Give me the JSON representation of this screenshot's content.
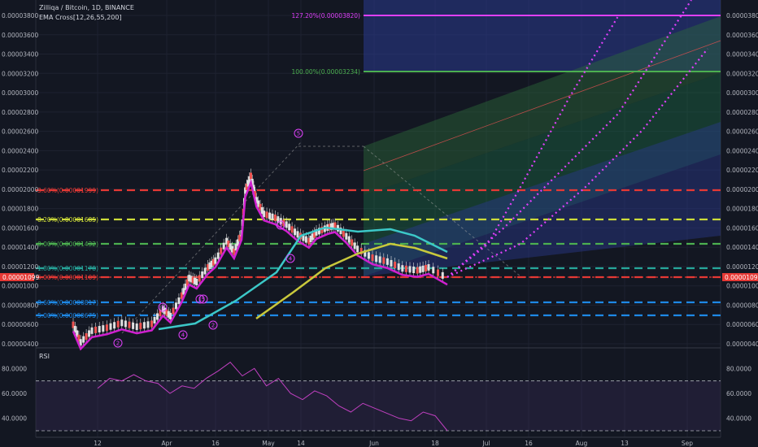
{
  "header": {
    "symbol": "Zilliqa / Bitcoin, 1D, BINANCE",
    "indicator": "EMA Cross[12,26,55,200]",
    "rsi_label": "RSI"
  },
  "chart_data": [
    {
      "type": "line",
      "title": "Zilliqa / Bitcoin, 1D, BINANCE",
      "x_ticks": [
        "12",
        "Apr",
        "16",
        "May",
        "14",
        "Jun",
        "18",
        "Jul",
        "16",
        "Aug",
        "13",
        "Sep"
      ],
      "y_ticks": [
        "0.00003800",
        "0.00003600",
        "0.00003400",
        "0.00003200",
        "0.00003000",
        "0.00002800",
        "0.00002600",
        "0.00002400",
        "0.00002200",
        "0.00002000",
        "0.00001800",
        "0.00001600",
        "0.00001400",
        "0.00001200",
        "0.00001000",
        "0.00000800",
        "0.00000600",
        "0.00000400"
      ],
      "ylim": [
        3.6e-06,
        3.9e-06
      ],
      "last_price": "0.00001099",
      "price_series": [
        {
          "x": 0.0,
          "y": 6.2e-06
        },
        {
          "x": 0.02,
          "y": 4.4e-06
        },
        {
          "x": 0.05,
          "y": 5.6e-06
        },
        {
          "x": 0.09,
          "y": 5.9e-06
        },
        {
          "x": 0.13,
          "y": 6.4e-06
        },
        {
          "x": 0.17,
          "y": 6e-06
        },
        {
          "x": 0.21,
          "y": 6.3e-06
        },
        {
          "x": 0.24,
          "y": 7.8e-06
        },
        {
          "x": 0.26,
          "y": 7.1e-06
        },
        {
          "x": 0.29,
          "y": 9.2e-06
        },
        {
          "x": 0.31,
          "y": 1.1e-05
        },
        {
          "x": 0.33,
          "y": 1.06e-05
        },
        {
          "x": 0.36,
          "y": 1.21e-05
        },
        {
          "x": 0.38,
          "y": 1.28e-05
        },
        {
          "x": 0.41,
          "y": 1.48e-05
        },
        {
          "x": 0.43,
          "y": 1.37e-05
        },
        {
          "x": 0.45,
          "y": 1.56e-05
        },
        {
          "x": 0.46,
          "y": 2e-05
        },
        {
          "x": 0.475,
          "y": 2.15e-05
        },
        {
          "x": 0.49,
          "y": 1.9e-05
        },
        {
          "x": 0.51,
          "y": 1.76e-05
        },
        {
          "x": 0.54,
          "y": 1.72e-05
        },
        {
          "x": 0.57,
          "y": 1.65e-05
        },
        {
          "x": 0.6,
          "y": 1.55e-05
        },
        {
          "x": 0.63,
          "y": 1.48e-05
        },
        {
          "x": 0.65,
          "y": 1.57e-05
        },
        {
          "x": 0.68,
          "y": 1.62e-05
        },
        {
          "x": 0.7,
          "y": 1.64e-05
        },
        {
          "x": 0.73,
          "y": 1.53e-05
        },
        {
          "x": 0.76,
          "y": 1.4e-05
        },
        {
          "x": 0.8,
          "y": 1.31e-05
        },
        {
          "x": 0.84,
          "y": 1.27e-05
        },
        {
          "x": 0.88,
          "y": 1.2e-05
        },
        {
          "x": 0.92,
          "y": 1.18e-05
        },
        {
          "x": 0.95,
          "y": 1.21e-05
        },
        {
          "x": 1.0,
          "y": 1.1e-05
        }
      ],
      "ema_series": [
        {
          "name": "EMA 12",
          "color": "#d020d0"
        },
        {
          "name": "EMA 26",
          "color": "#3cc8c8"
        },
        {
          "name": "EMA 55",
          "color": "#c8c83c"
        }
      ],
      "fib_levels": [
        {
          "label": "127.20%(0.00003820)",
          "color": "#e040fb"
        },
        {
          "label": "100.00%(0.00003234)",
          "color": "#4caf50"
        },
        {
          "label": "3.60%(0.00001999)",
          "color": "#e53935"
        },
        {
          "label": "8.20%(0.00001685)",
          "color": "#cddc39"
        },
        {
          "label": "0.00%(0.00001432)",
          "color": "#4caf50"
        },
        {
          "label": "1.80%(0.00001178)",
          "color": "#26a69a"
        },
        {
          "label": "5.00%(0.00001109)",
          "color": "#e53935"
        },
        {
          "label": "8.60%(0.00000817)",
          "color": "#1e88e5"
        },
        {
          "label": "5.00%(0.00000675)",
          "color": "#1e88e5"
        }
      ],
      "wave_labels": [
        "5",
        "3",
        "4",
        "1",
        "5",
        "2",
        "3",
        "4",
        "2"
      ]
    },
    {
      "type": "line",
      "title": "RSI",
      "y_ticks": [
        "80.0000",
        "60.0000",
        "40.0000"
      ],
      "ylim": [
        30,
        90
      ],
      "series": [
        {
          "name": "RSI",
          "color": "#c040c0",
          "values": [
            64,
            72,
            70,
            75,
            70,
            68,
            60,
            66,
            64,
            72,
            78,
            85,
            74,
            80,
            66,
            72,
            60,
            55,
            62,
            58,
            50,
            45,
            52,
            48,
            44,
            40,
            38,
            45,
            42,
            30
          ]
        }
      ]
    }
  ]
}
